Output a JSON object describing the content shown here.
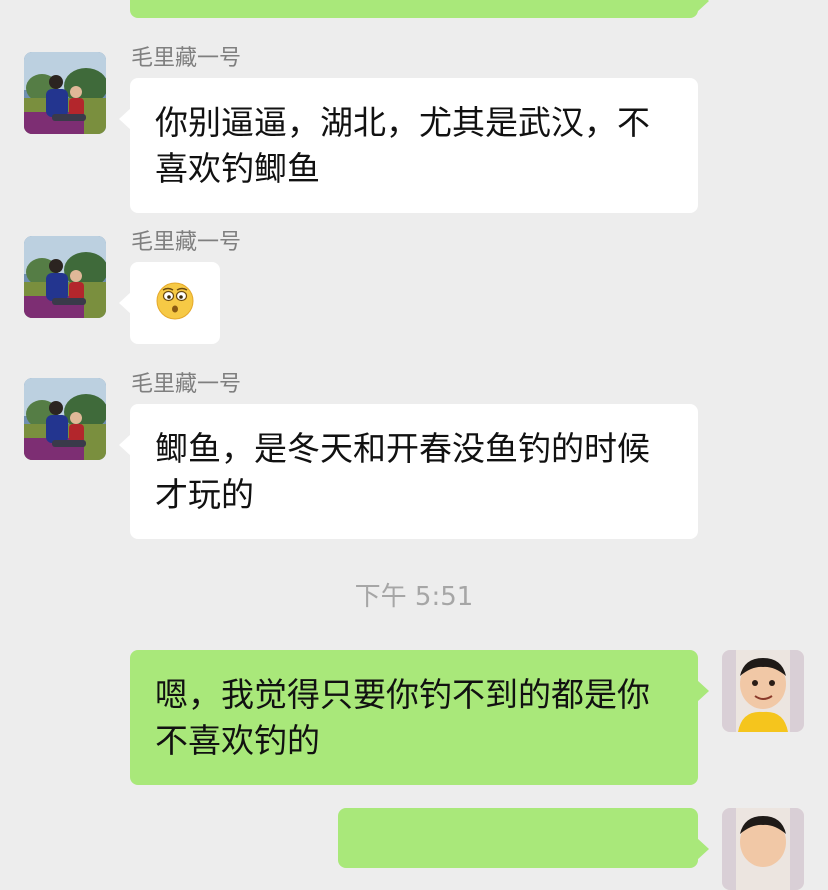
{
  "colors": {
    "background": "#ededed",
    "incoming_bubble": "#ffffff",
    "outgoing_bubble": "#a9e87a",
    "sender_text": "#7f7f7f",
    "timestamp_text": "#a6a6a6"
  },
  "messages": [
    {
      "sender": "毛里藏一号",
      "text": "你别逼逼，湖北，尤其是武汉，不喜欢钓鲫鱼"
    },
    {
      "sender": "毛里藏一号",
      "emoji": "surprised-face-emoji"
    },
    {
      "sender": "毛里藏一号",
      "text": "鲫鱼，是冬天和开春没鱼钓的时候才玩的"
    }
  ],
  "timestamp": "下午 5:51",
  "my_messages": [
    {
      "text": "嗯，我觉得只要你钓不到的都是你不喜欢钓的"
    }
  ]
}
